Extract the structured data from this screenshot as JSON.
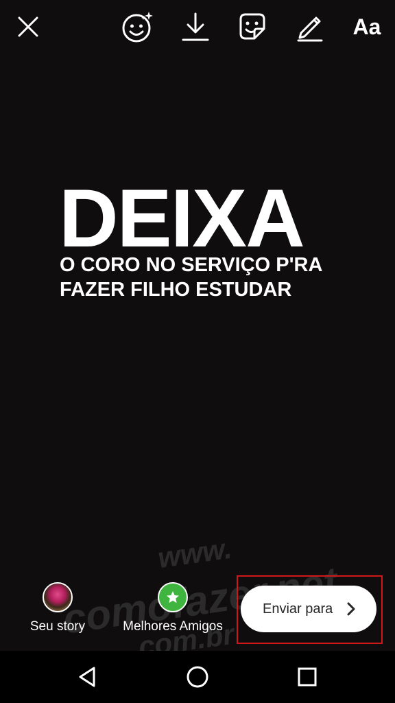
{
  "toolbar": {
    "close_icon": "close-icon",
    "effects_icon": "face-effects-icon",
    "download_icon": "download-icon",
    "sticker_icon": "sticker-icon",
    "draw_icon": "pen-icon",
    "text_label": "Aa"
  },
  "story": {
    "headline": "DEIXA",
    "subline": "O CORO NO SERVIÇO P'RA FAZER FILHO ESTUDAR",
    "background": "#0f0d0d"
  },
  "watermark": {
    "line1": "www.",
    "line2": "comofazer.net",
    "line3": ".com.br"
  },
  "share": {
    "your_story_label": "Seu story",
    "close_friends_label": "Melhores Amigos",
    "send_to_label": "Enviar para",
    "close_friends_color": "#3fb53f",
    "highlight_color": "#d01818"
  },
  "nav": {
    "back_icon": "back-triangle-icon",
    "home_icon": "home-circle-icon",
    "recents_icon": "recents-square-icon"
  }
}
